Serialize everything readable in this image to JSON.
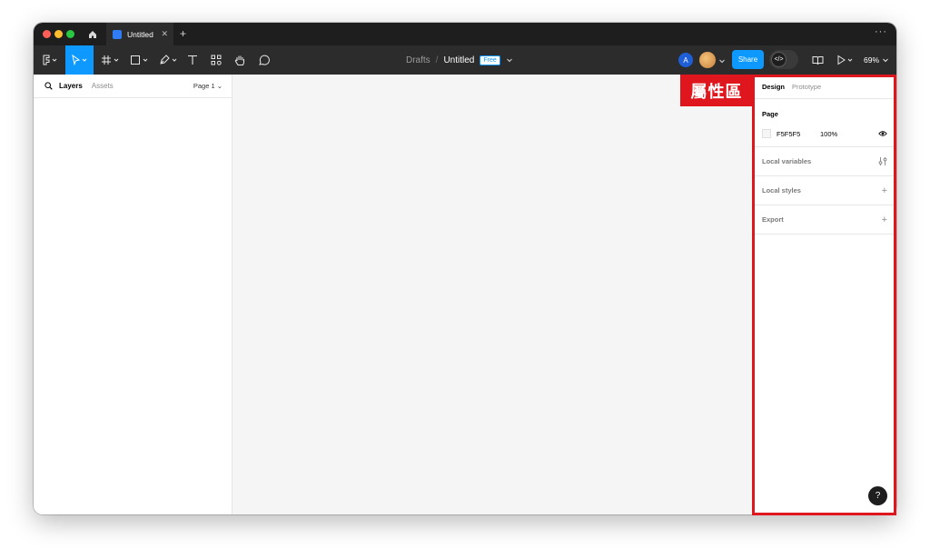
{
  "titlebar": {
    "tab_title": "Untitled",
    "new_tab": "+",
    "close": "✕",
    "more": "···"
  },
  "toolbar": {
    "breadcrumb_drafts": "Drafts",
    "breadcrumb_sep": "/",
    "file_name": "Untitled",
    "plan_badge": "Free",
    "user_initial": "A",
    "share_label": "Share",
    "zoom": "69%",
    "accent_color": "#0d99ff"
  },
  "left_panel": {
    "tab_layers": "Layers",
    "tab_assets": "Assets",
    "page_select": "Page 1 ⌄"
  },
  "right_panel": {
    "tab_design": "Design",
    "tab_prototype": "Prototype",
    "page_title": "Page",
    "page_color": "F5F5F5",
    "page_opacity": "100%",
    "local_variables": "Local variables",
    "local_styles": "Local styles",
    "export": "Export",
    "help": "?"
  },
  "annotation": {
    "label": "屬性區",
    "color": "#e0161e"
  }
}
